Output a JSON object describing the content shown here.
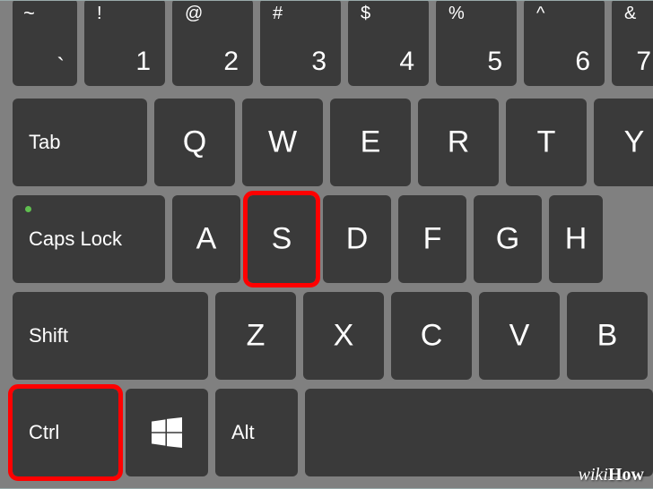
{
  "row0": {
    "tilde": {
      "sym": "~",
      "dig": "`"
    },
    "k1": {
      "sym": "!",
      "dig": "1"
    },
    "k2": {
      "sym": "@",
      "dig": "2"
    },
    "k3": {
      "sym": "#",
      "dig": "3"
    },
    "k4": {
      "sym": "$",
      "dig": "4"
    },
    "k5": {
      "sym": "%",
      "dig": "5"
    },
    "k6": {
      "sym": "^",
      "dig": "6"
    },
    "k7": {
      "sym": "&",
      "dig": "7"
    }
  },
  "row1": {
    "tab": "Tab",
    "q": "Q",
    "w": "W",
    "e": "E",
    "r": "R",
    "t": "T",
    "y": "Y"
  },
  "row2": {
    "caps": "Caps Lock",
    "a": "A",
    "s": "S",
    "d": "D",
    "f": "F",
    "g": "G",
    "h": "H"
  },
  "row3": {
    "shift": "Shift",
    "z": "Z",
    "x": "X",
    "c": "C",
    "v": "V",
    "b": "B"
  },
  "row4": {
    "ctrl": "Ctrl",
    "alt": "Alt"
  },
  "watermark": {
    "wiki": "wiki",
    "how": "How"
  },
  "highlighted_keys": [
    "s",
    "ctrl"
  ]
}
